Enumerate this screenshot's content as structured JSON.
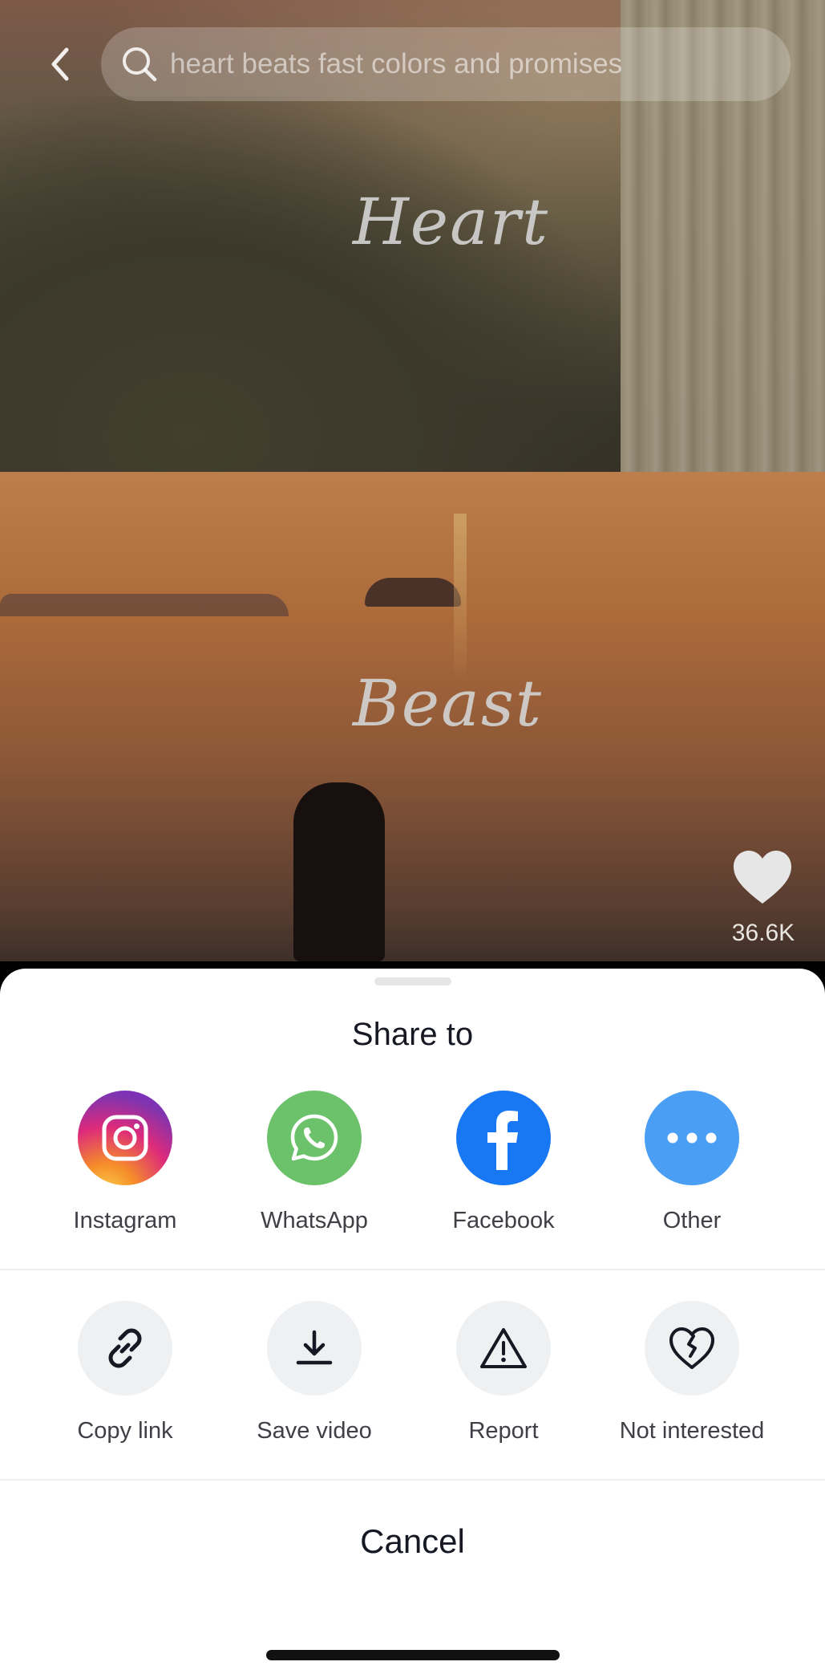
{
  "search": {
    "query": "heart beats fast colors and promises"
  },
  "video": {
    "overlay_text_top": "Heart",
    "overlay_text_bottom": "Beast",
    "like_count": "36.6K"
  },
  "share_sheet": {
    "title": "Share to",
    "apps": [
      {
        "label": "Instagram",
        "icon": "instagram-icon",
        "color": "#dd2a7b"
      },
      {
        "label": "WhatsApp",
        "icon": "whatsapp-icon",
        "color": "#6cc26b"
      },
      {
        "label": "Facebook",
        "icon": "facebook-icon",
        "color": "#1877f2"
      },
      {
        "label": "Other",
        "icon": "more-icon",
        "color": "#4a9ff5"
      }
    ],
    "actions": [
      {
        "label": "Copy link",
        "icon": "link-icon"
      },
      {
        "label": "Save video",
        "icon": "download-icon"
      },
      {
        "label": "Report",
        "icon": "warning-icon"
      },
      {
        "label": "Not interested",
        "icon": "broken-heart-icon"
      }
    ],
    "cancel_label": "Cancel"
  }
}
